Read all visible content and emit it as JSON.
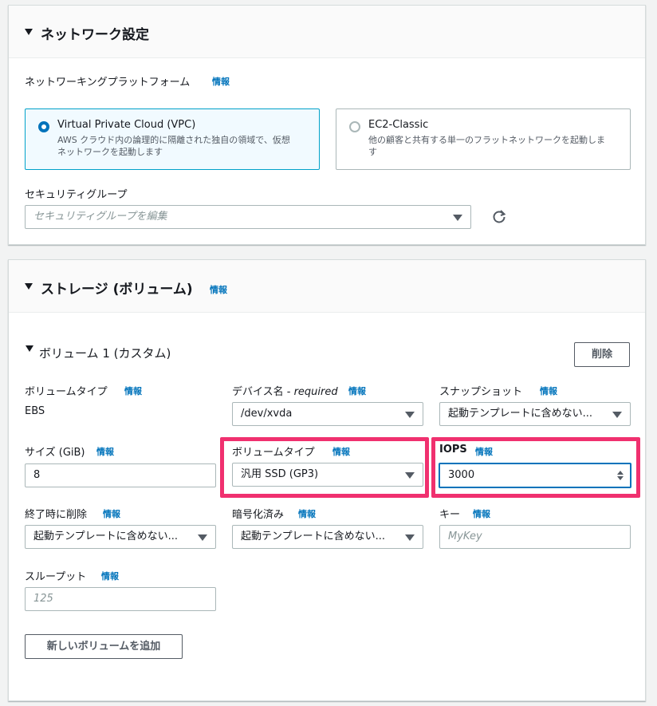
{
  "network": {
    "title": "ネットワーク設定",
    "platform_label": "ネットワーキングプラットフォーム",
    "info": "情報",
    "options": [
      {
        "title": "Virtual Private Cloud (VPC)",
        "desc": "AWS クラウド内の論理的に隔離された独自の領域で、仮想ネットワークを起動します"
      },
      {
        "title": "EC2-Classic",
        "desc": "他の顧客と共有する単一のフラットネットワークを起動します"
      }
    ],
    "security_group_label": "セキュリティグループ",
    "security_group_placeholder": "セキュリティグループを編集"
  },
  "storage": {
    "title": "ストレージ (ボリューム)",
    "info": "情報",
    "volume_title": "ボリューム 1 (カスタム)",
    "delete_label": "削除",
    "volume_type_label": "ボリュームタイプ",
    "volume_type_value": "EBS",
    "device_label": "デバイス名 - ",
    "device_required": "required",
    "device_value": "/dev/xvda",
    "snapshot_label": "スナップショット",
    "snapshot_value": "起動テンプレートに含めない...",
    "size_label": "サイズ (GiB)",
    "size_value": "8",
    "vtype_label": "ボリュームタイプ",
    "vtype_value": "汎用 SSD (GP3)",
    "iops_label": "IOPS",
    "iops_value": "3000",
    "delete_on_term_label": "終了時に削除",
    "delete_on_term_value": "起動テンプレートに含めない...",
    "encrypted_label": "暗号化済み",
    "encrypted_value": "起動テンプレートに含めない...",
    "key_label": "キー",
    "key_placeholder": "MyKey",
    "throughput_label": "スループット",
    "throughput_placeholder": "125",
    "add_volume_label": "新しいボリュームを追加"
  },
  "colors": {
    "highlight": "#f0306f",
    "link": "#0073bb",
    "selected_border": "#00a1c9"
  }
}
